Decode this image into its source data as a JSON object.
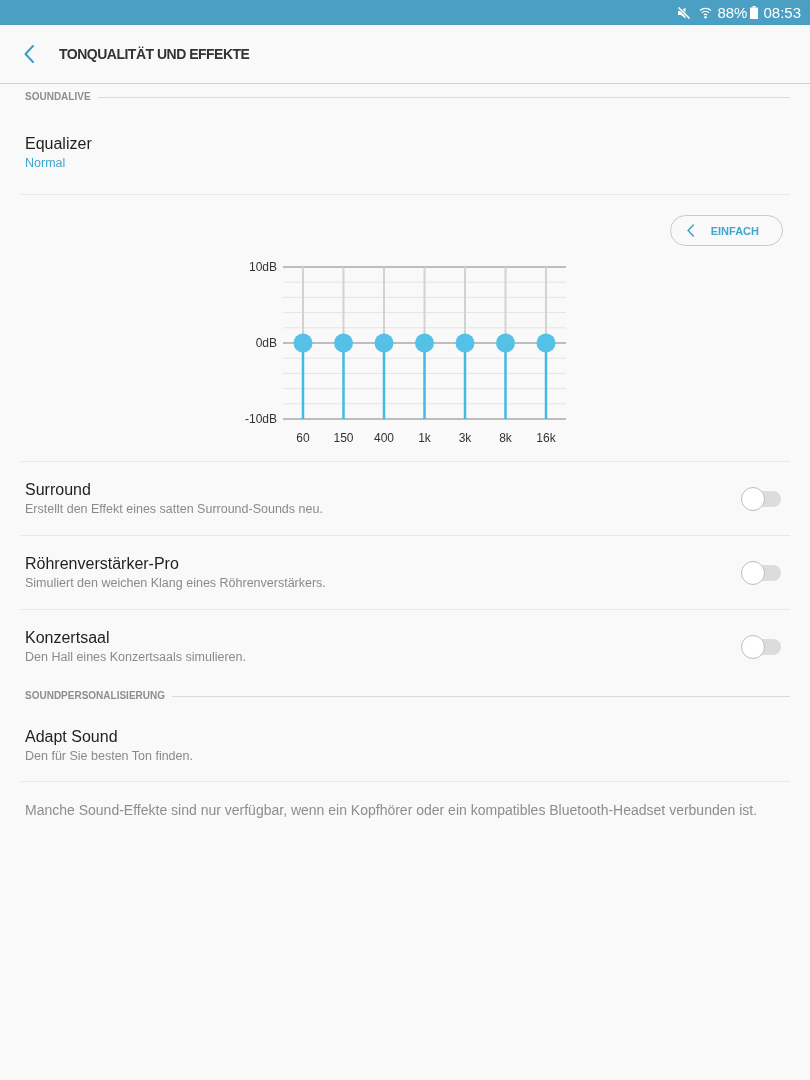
{
  "status_bar": {
    "battery": "88%",
    "time": "08:53"
  },
  "header": {
    "title": "TONQUALITÄT UND EFFEKTE"
  },
  "sections": [
    {
      "heading": "SOUNDALIVE",
      "items": [
        {
          "kind": "value",
          "title": "Equalizer",
          "value": "Normal"
        },
        {
          "kind": "equalizer",
          "mode_button": "EINFACH",
          "chart_data": {
            "type": "scatter",
            "categories": [
              "60",
              "150",
              "400",
              "1k",
              "3k",
              "8k",
              "16k"
            ],
            "values": [
              0,
              0,
              0,
              0,
              0,
              0,
              0
            ],
            "ylim": [
              -10,
              10
            ],
            "yticks": [
              {
                "value": -10,
                "label": "-10dB"
              },
              {
                "value": 0,
                "label": "0dB"
              },
              {
                "value": 10,
                "label": "10dB"
              }
            ]
          }
        },
        {
          "kind": "switch",
          "title": "Surround",
          "subtitle": "Erstellt den Effekt eines satten Surround-Sounds neu.",
          "on": false
        },
        {
          "kind": "switch",
          "title": "Röhrenverstärker-Pro",
          "subtitle": "Simuliert den weichen Klang eines Röhrenverstärkers.",
          "on": false
        },
        {
          "kind": "switch",
          "title": "Konzertsaal",
          "subtitle": "Den Hall eines Konzertsaals simulieren.",
          "on": false
        }
      ]
    },
    {
      "heading": "SOUNDPERSONALISIERUNG",
      "items": [
        {
          "kind": "text",
          "title": "Adapt Sound",
          "subtitle": "Den für Sie besten Ton finden."
        }
      ]
    }
  ],
  "footnote": "Manche Sound-Effekte sind nur verfügbar, wenn ein Kopfhörer oder ein kompatibles Bluetooth-Headset verbunden ist."
}
